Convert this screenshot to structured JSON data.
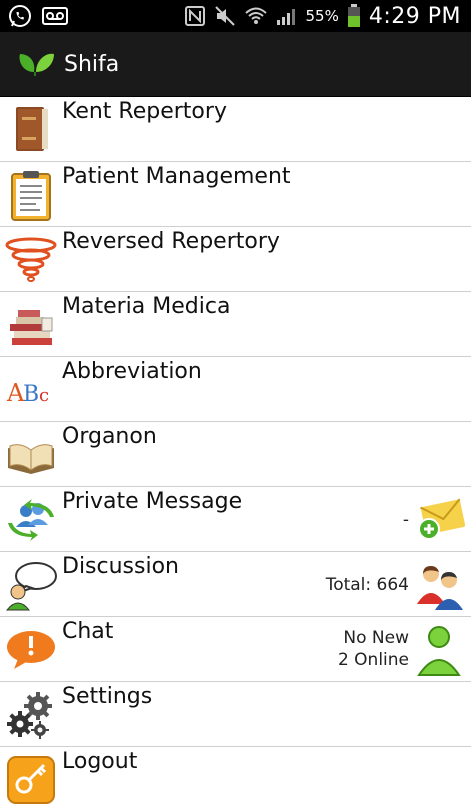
{
  "status_bar": {
    "battery_percent": "55%",
    "time": "4:29 PM"
  },
  "app_bar": {
    "title": "Shifa"
  },
  "menu": [
    {
      "label": "Kent Repertory",
      "icon": "book-icon"
    },
    {
      "label": "Patient Management",
      "icon": "clipboard-icon"
    },
    {
      "label": "Reversed Repertory",
      "icon": "tornado-icon"
    },
    {
      "label": "Materia Medica",
      "icon": "books-stack-icon"
    },
    {
      "label": "Abbreviation",
      "icon": "abc-icon"
    },
    {
      "label": "Organon",
      "icon": "open-book-icon"
    },
    {
      "label": "Private Message",
      "icon": "users-sync-icon",
      "meta": "-",
      "right_icon": "mail-add-icon"
    },
    {
      "label": "Discussion",
      "icon": "chat-bubble-user-icon",
      "meta": "Total: 664",
      "right_icon": "group-users-icon"
    },
    {
      "label": "Chat",
      "icon": "alert-bubble-icon",
      "meta_line1": "No New",
      "meta_line2": "2 Online",
      "right_icon": "online-user-icon"
    },
    {
      "label": "Settings",
      "icon": "gears-icon"
    },
    {
      "label": "Logout",
      "icon": "key-icon"
    }
  ]
}
